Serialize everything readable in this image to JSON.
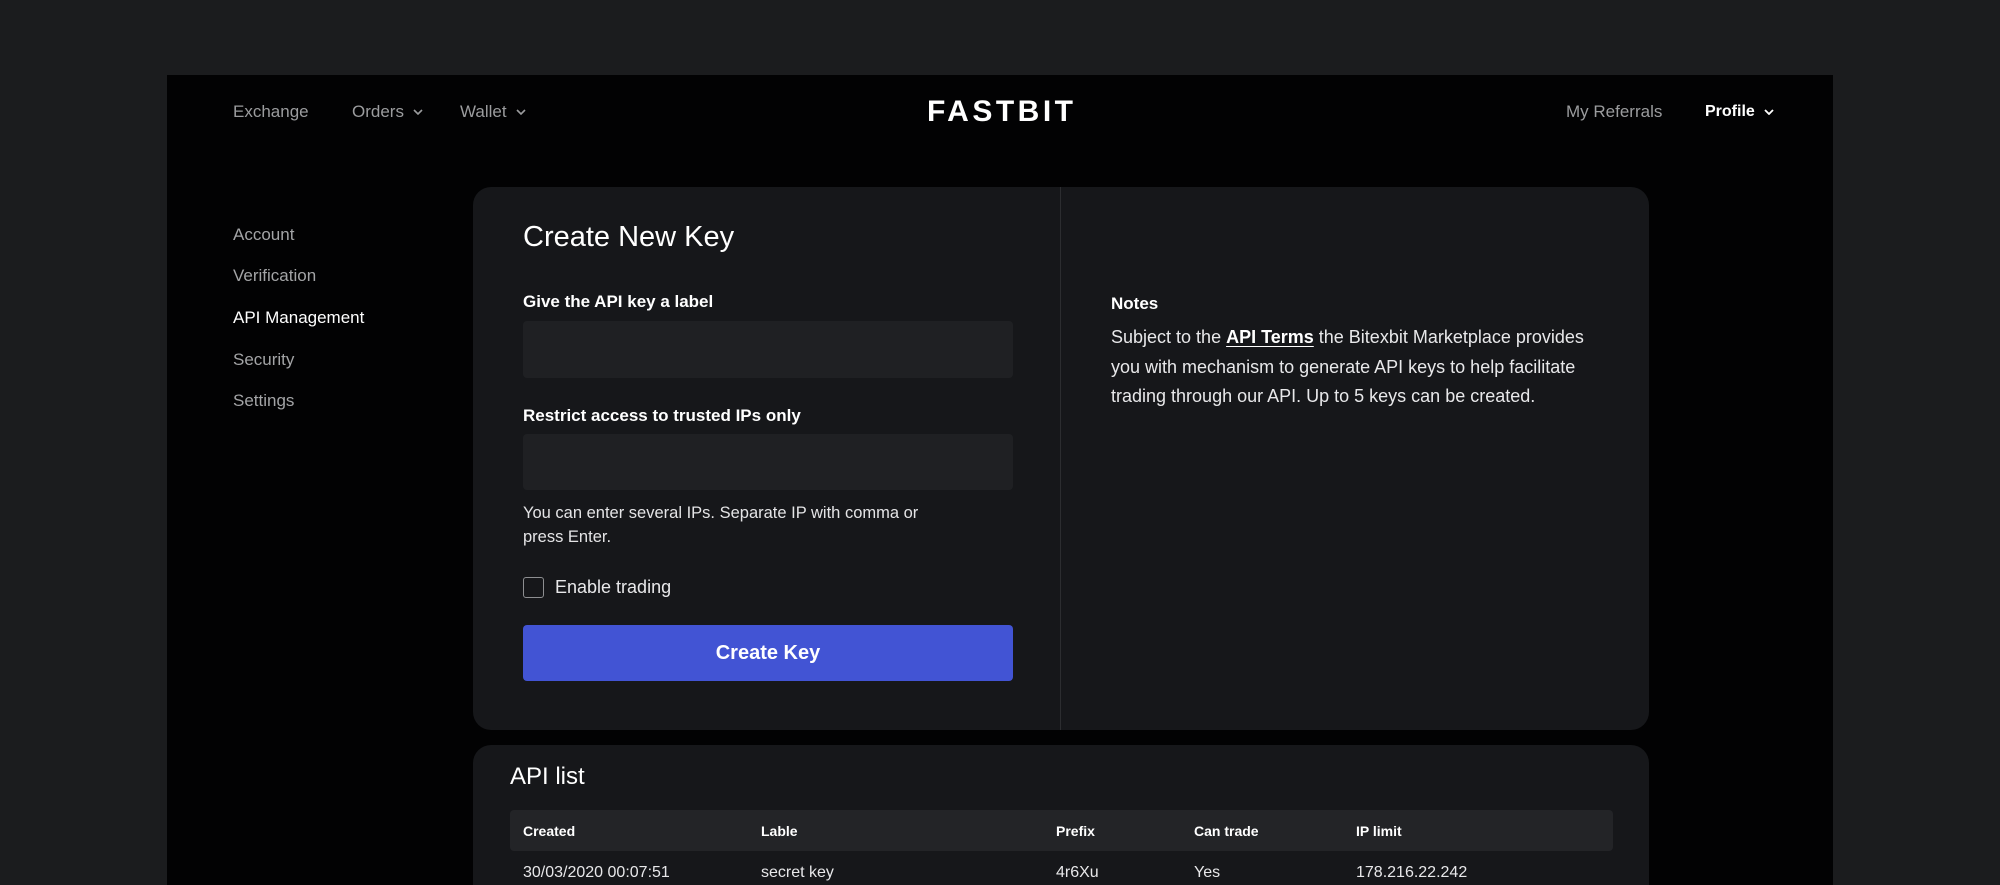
{
  "app": {
    "brand": "FASTBIT"
  },
  "colors": {
    "page_bg": "#1b1c1e",
    "frame_bg": "#020203",
    "card_bg": "#16171a",
    "input_bg": "#1f2023",
    "table_header_bg": "#232427",
    "accent": "#4254d4",
    "muted_text": "#9b9c9e",
    "text": "#ffffff"
  },
  "nav": {
    "left": [
      {
        "label": "Exchange"
      },
      {
        "label": "Orders",
        "icon": "chevron-down-icon"
      },
      {
        "label": "Wallet",
        "icon": "chevron-down-icon"
      }
    ],
    "right": [
      {
        "label": "My Referrals"
      },
      {
        "label": "Profile",
        "icon": "chevron-down-icon"
      }
    ]
  },
  "sidebar": {
    "items": [
      {
        "label": "Account"
      },
      {
        "label": "Verification"
      },
      {
        "label": "API Management",
        "active": true
      },
      {
        "label": "Security"
      },
      {
        "label": "Settings"
      }
    ]
  },
  "create_key": {
    "title": "Create New Key",
    "label_field": {
      "label": "Give the API key a label"
    },
    "ip_field": {
      "label": "Restrict access to trusted IPs only",
      "help_lines": [
        "You can enter several IPs. Separate IP with comma or",
        "press Enter."
      ]
    },
    "enable_trading": {
      "label": "Enable trading",
      "checked": false
    },
    "submit_label": "Create Key"
  },
  "notes": {
    "title": "Notes",
    "text_before": "Subject to the ",
    "link": "API Terms",
    "text_after": " the Bitexbit Marketplace provides you with mechanism to generate API keys to help facilitate trading through our API. Up to 5 keys can be created."
  },
  "api_list": {
    "title": "API list",
    "columns": [
      "Created",
      "Lable",
      "Prefix",
      "Can trade",
      "IP limit"
    ],
    "rows": [
      {
        "created": "30/03/2020 00:07:51",
        "label": "secret key",
        "prefix": "4r6Xu",
        "can_trade": "Yes",
        "ip_limit": "178.216.22.242"
      }
    ]
  }
}
